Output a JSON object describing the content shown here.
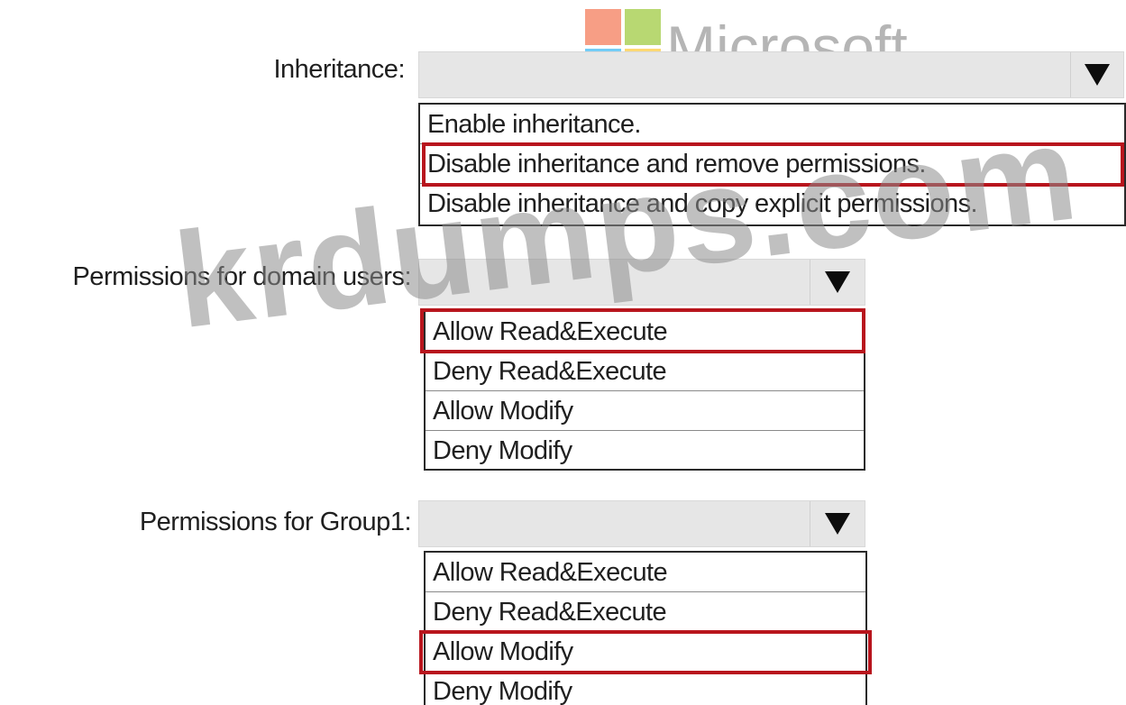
{
  "watermarks": {
    "logo_text": "Microsoft",
    "site_text": "krdumps.com",
    "logo_colors": [
      "#f25022",
      "#7fba00",
      "#00a4ef",
      "#ffb900"
    ]
  },
  "inheritance": {
    "label": "Inheritance:",
    "selected_value": "",
    "options": [
      "Enable inheritance.",
      "Disable inheritance and remove permissions.",
      "Disable inheritance and copy explicit permissions."
    ],
    "highlighted_option": "Disable inheritance and remove permissions."
  },
  "domain_users": {
    "label": "Permissions for domain users:",
    "selected_value": "",
    "options": [
      "Allow Read&Execute",
      "Deny Read&Execute",
      "Allow Modify",
      "Deny Modify"
    ],
    "highlighted_option": "Allow Read&Execute"
  },
  "group1": {
    "label": "Permissions for Group1:",
    "selected_value": "",
    "options": [
      "Allow Read&Execute",
      "Deny Read&Execute",
      "Allow Modify",
      "Deny Modify"
    ],
    "highlighted_option": "Allow Modify"
  },
  "colors": {
    "highlight_border": "#b8151d",
    "dropdown_bg": "#e6e6e6"
  }
}
